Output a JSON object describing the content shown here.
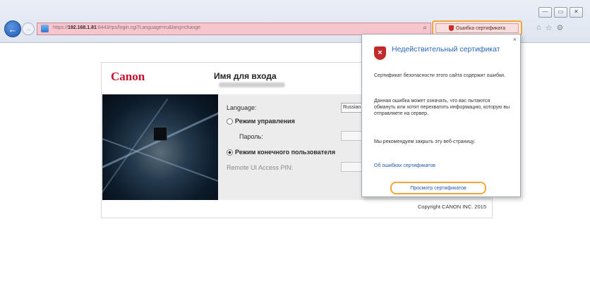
{
  "browser": {
    "url_prefix": "https://",
    "url_host": "192.168.1.81",
    "url_rest": ":8443/rps/login.cgi?Language=ru&lang=change",
    "cert_error_label": "Ошибка сертификата",
    "window_buttons": [
      "—",
      "▭",
      "✕"
    ],
    "toolbar_icons": [
      "⌂",
      "☆",
      "⚙"
    ]
  },
  "page": {
    "logo": "Canon",
    "title": "Имя для входа",
    "form": {
      "language_label": "Language:",
      "language_value": "Russian",
      "admin_mode_label": "Режим управления",
      "password_label": "Пароль:",
      "user_mode_label": "Режим конечного пользователя",
      "pin_label": "Remote UI Access PIN:",
      "selected_mode": "user"
    },
    "copyright": "Copyright CANON INC. 2015"
  },
  "popup": {
    "title": "Недействительный сертификат",
    "p1": "Сертификат безопасности этого сайта содержит ошибки.",
    "p2": "Данная ошибка может означать, что вас пытаются обмануть или хотят перехватить информацию, которую вы отправляете на сервер.",
    "p3": "Мы рекомендуем закрыть эту веб-страницу.",
    "link": "Об ошибках сертификатов",
    "button": "Просмотр сертификатов",
    "close": "×"
  },
  "colors": {
    "address_error": "#f7c6cd",
    "highlight": "#f4a53a",
    "canon_red": "#c8102e",
    "link": "#2a66b8"
  }
}
